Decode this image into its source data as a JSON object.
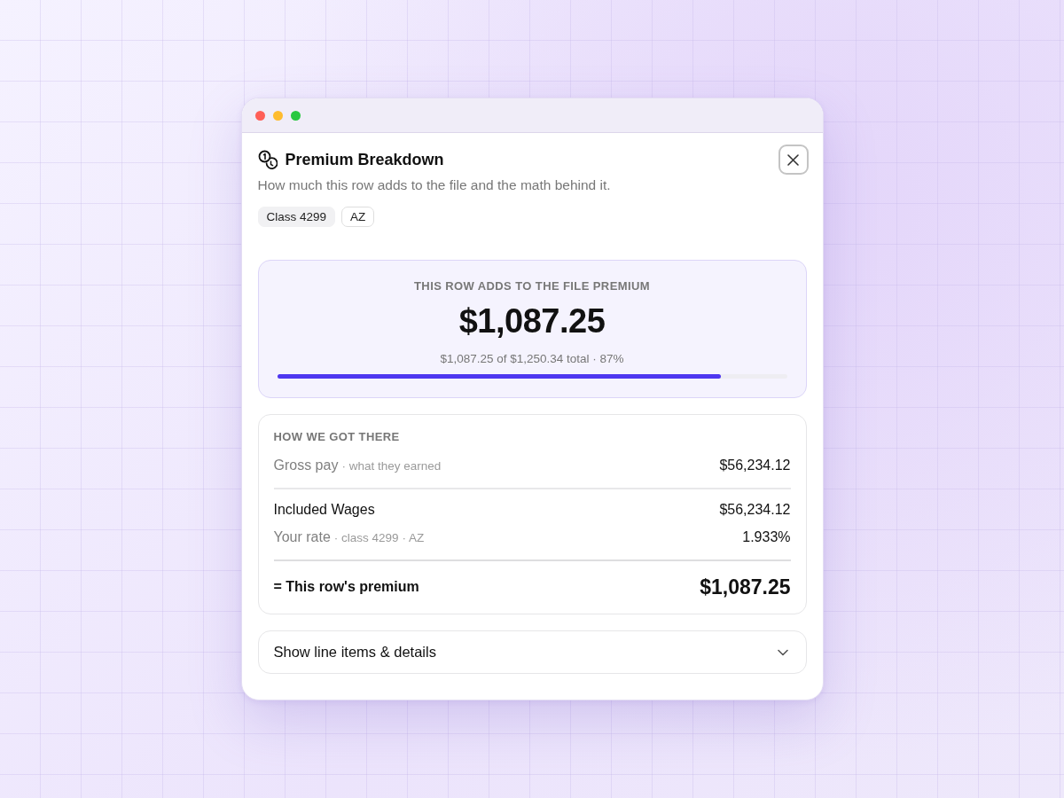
{
  "dialog": {
    "title": "Premium Breakdown",
    "subtitle": "How much this row adds to the file and the math behind it.",
    "tags": [
      {
        "label": "Class 4299",
        "kind": "filled"
      },
      {
        "label": "AZ",
        "kind": "outline"
      }
    ]
  },
  "summary": {
    "label": "THIS ROW ADDS TO THE FILE PREMIUM",
    "amount": "$1,087.25",
    "detail": "$1,087.25 of $1,250.34 total · 87%",
    "level": 0.87
  },
  "breakdown": {
    "heading": "HOW WE GOT THERE",
    "sections": [
      {
        "rows": [
          {
            "label": "Gross pay",
            "note": "· what they earned",
            "value": "$56,234.12",
            "muted": true
          }
        ]
      },
      {
        "rows": [
          {
            "label": "Included Wages",
            "value": "$56,234.12",
            "muted": false
          },
          {
            "label": "Your rate",
            "note": "· class 4299 · AZ",
            "value": "1.933%",
            "muted": true
          }
        ]
      }
    ],
    "total": {
      "label": "= This row's premium",
      "value": "$1,087.25"
    }
  },
  "expander": {
    "label": "Show line items & details",
    "expanded": false
  }
}
